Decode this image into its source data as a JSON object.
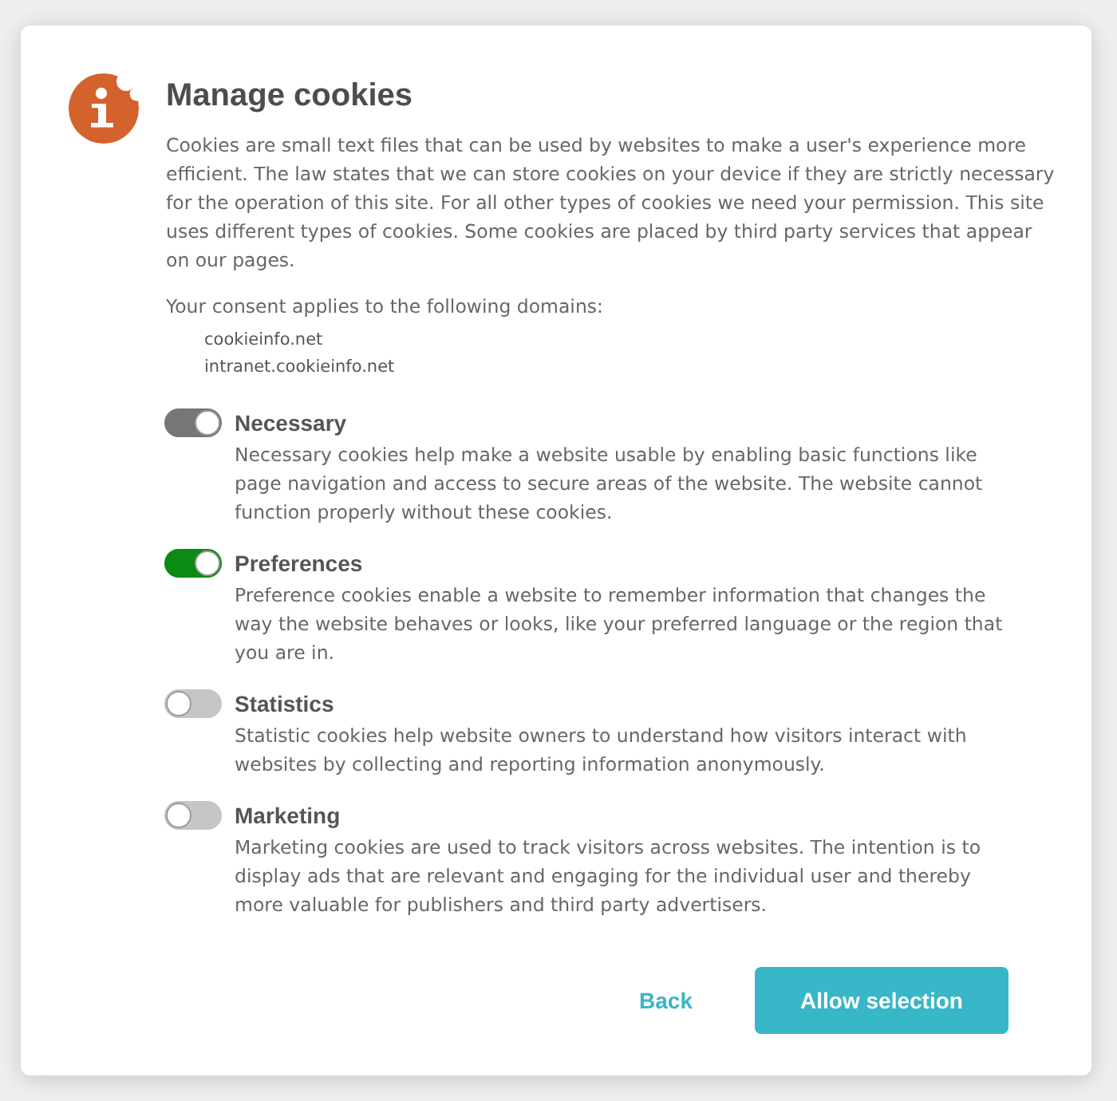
{
  "dialog": {
    "title": "Manage cookies",
    "intro": "Cookies are small text files that can be used by websites to make a user's experience more efficient. The law states that we can store cookies on your device if they are strictly necessary for the operation of this site. For all other types of cookies we need your permission. This site uses different types of cookies. Some cookies are placed by third party services that appear on our pages.",
    "consent_label": "Your consent applies to the following domains:",
    "domains": [
      "cookieinfo.net",
      "intranet.cookieinfo.net"
    ]
  },
  "categories": [
    {
      "name": "Necessary",
      "description": "Necessary cookies help make a website usable by enabling basic functions like page navigation and access to secure areas of the website. The website cannot function properly without these cookies.",
      "checked": true,
      "disabled": true
    },
    {
      "name": "Preferences",
      "description": "Preference cookies enable a website to remember information that changes the way the website behaves or looks, like your preferred language or the region that you are in.",
      "checked": true,
      "disabled": false
    },
    {
      "name": "Statistics",
      "description": "Statistic cookies help website owners to understand how visitors interact with websites by collecting and reporting information anonymously.",
      "checked": false,
      "disabled": false
    },
    {
      "name": "Marketing",
      "description": "Marketing cookies are used to track visitors across websites. The intention is to display ads that are relevant and engaging for the individual user and thereby more valuable for publishers and third party advertisers.",
      "checked": false,
      "disabled": false
    }
  ],
  "buttons": [
    {
      "label": "Back",
      "kind": "link"
    },
    {
      "label": "Allow selection",
      "kind": "primary"
    }
  ]
}
